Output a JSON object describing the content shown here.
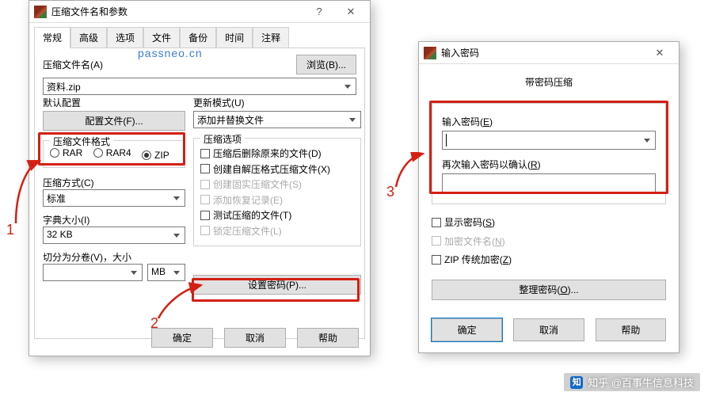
{
  "watermark": "passneo.cn",
  "annotations": {
    "n1": "1",
    "n2": "2",
    "n3": "3"
  },
  "zhihu_attr": "知乎 @百事牛信息科技",
  "dlg1": {
    "title": "压缩文件名和参数",
    "tabs": [
      "常规",
      "高级",
      "选项",
      "文件",
      "备份",
      "时间",
      "注释"
    ],
    "archive_name_label": "压缩文件名(A)",
    "archive_name_value": "资料.zip",
    "browse_btn": "浏览(B)...",
    "default_config_label": "默认配置",
    "profiles_btn": "配置文件(F)...",
    "update_mode_label": "更新模式(U)",
    "update_mode_value": "添加并替换文件",
    "format_group": "压缩文件格式",
    "formats": [
      "RAR",
      "RAR4",
      "ZIP"
    ],
    "format_selected": "ZIP",
    "method_label": "压缩方式(C)",
    "method_value": "标准",
    "dict_label": "字典大小(I)",
    "dict_value": "32 KB",
    "split_label": "切分为分卷(V)，大小",
    "split_value": "",
    "split_unit": "MB",
    "options_group": "压缩选项",
    "opts": [
      {
        "label": "压缩后删除原来的文件(D)",
        "disabled": false
      },
      {
        "label": "创建自解压格式压缩文件(X)",
        "disabled": false
      },
      {
        "label": "创建固实压缩文件(S)",
        "disabled": true
      },
      {
        "label": "添加恢复记录(E)",
        "disabled": true
      },
      {
        "label": "测试压缩的文件(T)",
        "disabled": false
      },
      {
        "label": "锁定压缩文件(L)",
        "disabled": true
      }
    ],
    "set_password_btn": "设置密码(P)...",
    "ok": "确定",
    "cancel": "取消",
    "help": "帮助"
  },
  "dlg2": {
    "title": "输入密码",
    "headline": "带密码压缩",
    "pwd_label": "输入密码(E)",
    "pwd2_label": "再次输入密码以确认(R)",
    "show_pwd": "显示密码(S)",
    "encrypt_names": "加密文件名(N)",
    "zip_legacy": "ZIP 传统加密(Z)",
    "organize_btn": "整理密码(O)...",
    "ok": "确定",
    "cancel": "取消",
    "help": "帮助"
  }
}
